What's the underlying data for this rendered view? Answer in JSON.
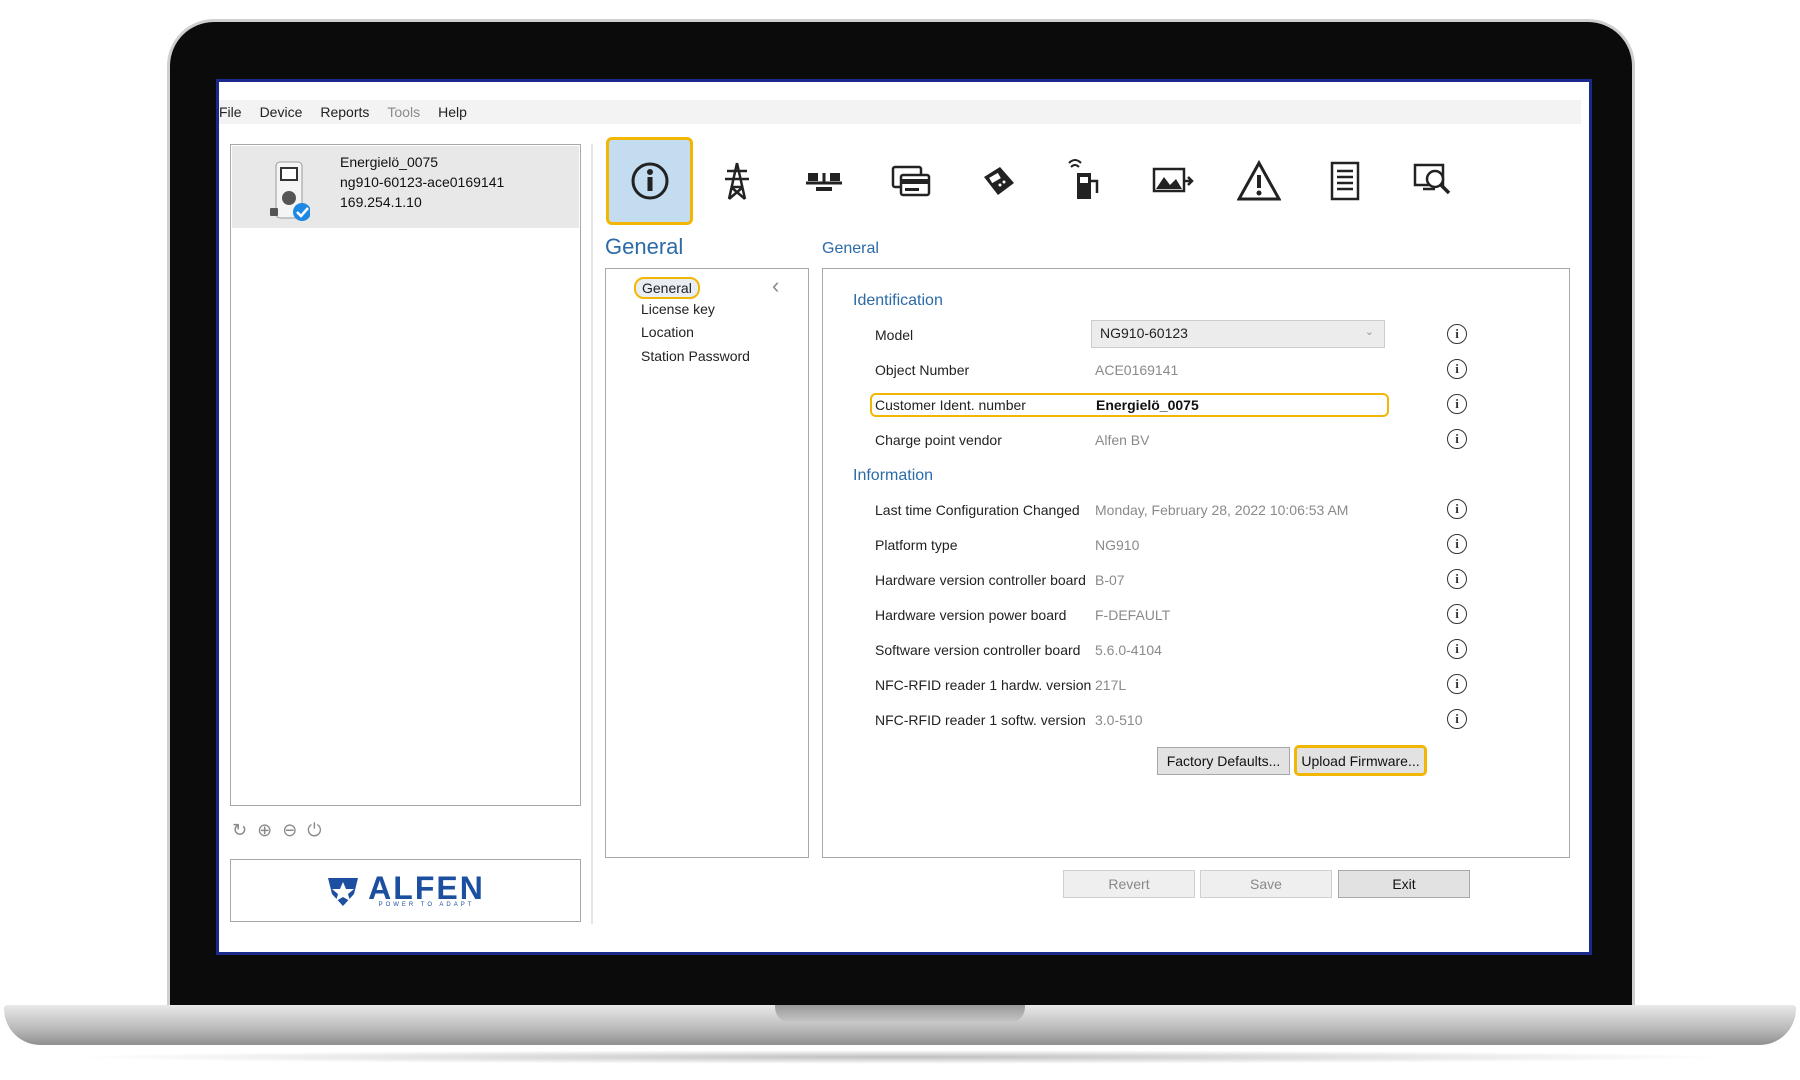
{
  "menu": [
    "File",
    "Device",
    "Reports",
    "Tools",
    "Help"
  ],
  "device": {
    "name": "Energielö_0075",
    "id": "ng910-60123-ace0169141",
    "ip": "169.254.1.10"
  },
  "logo": {
    "brand": "ALFEN",
    "tagline": "POWER TO ADAPT"
  },
  "toolbar_icons": [
    "info-icon",
    "power-tower-icon",
    "balance-icon",
    "card-icon",
    "payment-terminal-icon",
    "charging-station-icon",
    "image-upload-icon",
    "warning-icon",
    "document-icon",
    "diagnostics-icon"
  ],
  "section_title": "General",
  "content_title": "General",
  "nav": {
    "items": [
      "General",
      "License key",
      "Location",
      "Station Password"
    ]
  },
  "identification": {
    "label": "Identification",
    "rows": [
      {
        "label": "Model",
        "value": "NG910-60123"
      },
      {
        "label": "Object Number",
        "value": "ACE0169141"
      },
      {
        "label": "Customer Ident. number",
        "value": "Energielö_0075"
      },
      {
        "label": "Charge point vendor",
        "value": "Alfen BV"
      }
    ]
  },
  "information": {
    "label": "Information",
    "rows": [
      {
        "label": "Last time Configuration Changed",
        "value": "Monday, February 28, 2022 10:06:53 AM"
      },
      {
        "label": "Platform type",
        "value": "NG910"
      },
      {
        "label": "Hardware version controller board",
        "value": "B-07"
      },
      {
        "label": "Hardware version power board",
        "value": "F-DEFAULT"
      },
      {
        "label": "Software version controller board",
        "value": "5.6.0-4104"
      },
      {
        "label": "NFC-RFID reader 1 hardw. version",
        "value": "217L"
      },
      {
        "label": "NFC-RFID reader 1 softw. version",
        "value": "3.0-510"
      }
    ]
  },
  "buttons": {
    "factory_defaults": "Factory Defaults...",
    "upload_firmware": "Upload Firmware...",
    "revert": "Revert",
    "save": "Save",
    "exit": "Exit"
  },
  "colors": {
    "accent": "#2c6aa8",
    "highlight": "#f2b705",
    "brand": "#1d4fa0"
  }
}
